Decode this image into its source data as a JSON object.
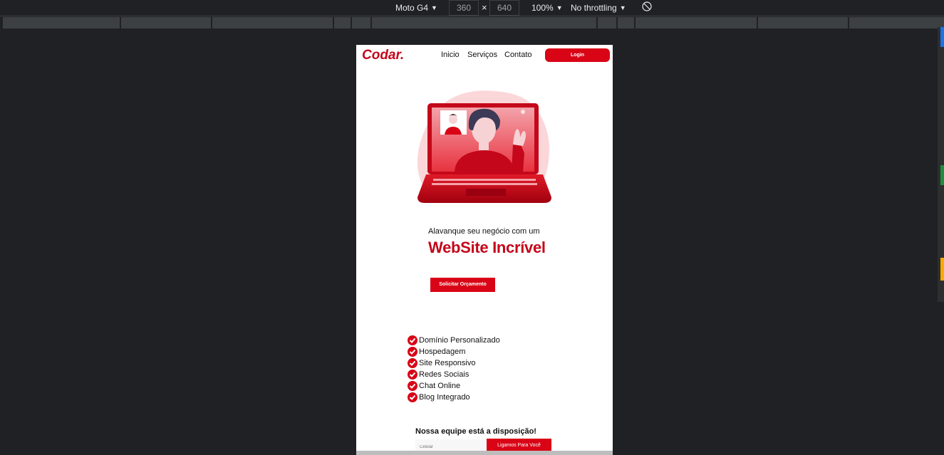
{
  "devtools": {
    "device": "Moto G4",
    "width": "360",
    "height": "640",
    "zoom": "100%",
    "throttling": "No throttling"
  },
  "site": {
    "logo": "Codar.",
    "nav": [
      "Inicio",
      "Serviços",
      "Contato"
    ],
    "login_label": "Login",
    "subheading": "Alavanque seu negócio com um",
    "headline": "WebSite Incrível",
    "cta_label": "Solicitar Orçamento",
    "features": [
      "Domínio Personalizado",
      "Hospedagem",
      "Site Responsivo",
      "Redes Sociais",
      "Chat Online",
      "Blog Integrado"
    ],
    "team_heading": "Nossa equipe está a disposição!",
    "phone_placeholder": "Celular",
    "call_label": "Ligamos Para Você"
  },
  "colors": {
    "brand": "#d90416",
    "devtools_bg": "#202124"
  }
}
